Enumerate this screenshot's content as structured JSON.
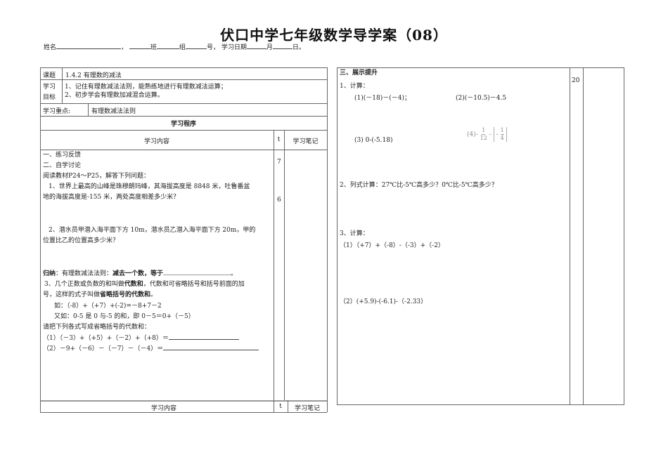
{
  "title": "伏口中学七年级数学导学案（08）",
  "info_line": {
    "name": "姓名",
    "class": "班",
    "group": "组",
    "number": "号，",
    "date_label": "学习日期",
    "month": "月",
    "day": "日。",
    "comma": "，"
  },
  "left": {
    "topic_label": "课题",
    "topic": "1.4.2 有理数的减法",
    "goal_label_1": "学习",
    "goal_label_2": "目标",
    "goals": [
      "1、记住有理数减法法则，能熟练地进行有理数减法运算；",
      "2、初步学会有理数加减混合运算。"
    ],
    "focus_label": "学习重点:",
    "focus": "有理数减法法则",
    "procedure": "学习程序",
    "col_content": "学习内容",
    "col_t": "t",
    "col_notes": "学习笔记",
    "t_values": [
      "7",
      "6"
    ],
    "lines": {
      "s1": "一、练习反馈",
      "s2": "二、自学讨论",
      "read": "阅读教材P24～P25，解答下列问题：",
      "q1a": "1、世界上最高的山峰是珠穆朗玛峰，其海拔高度是 8848 米，吐鲁番盆",
      "q1b": "地的海拔高度是-155 米，两处高度相差多少米？",
      "q2a": "2、潜水员甲潜入海平面下方 10m，潜水员乙潜入海平面下方 20m，甲的",
      "q2b": "位置比乙的位置高多少米？",
      "sum_label": "归纳",
      "sum_text": "：有理数减法法则：",
      "sum_bold": "减去一个数，等于",
      "sum_end": "。",
      "q3a_1": "3、几个正数或负数的和叫做",
      "q3a_b1": "代数和",
      "q3a_2": "，代数和可省略括号和括号前面的加",
      "q3b_1": "号，这样的式子叫做",
      "q3b_b": "省略括号的代数和",
      "q3b_2": "。",
      "ex1": "如：（-8）+（+7）+(-2)=－8+7－2",
      "ex2": "又如：0-5 是 0 与-5 的和，即 0－5＝0+（－5）",
      "ask": "请把下列各式写成省略括号的代数和：",
      "e1": "（1）（－3）+（+5）+（－2）+（+8）＝",
      "e2": "（2）－9+（－6）－（－7）－（－4）＝"
    },
    "footer_content": "学习内容",
    "footer_t": "t",
    "footer_notes": "学习笔记"
  },
  "right": {
    "section": "三、展示提升",
    "t_value": "20",
    "c1": "1、计算：",
    "p1": "(1)(－18)－(－4)；",
    "p2": "(2)(－10.5)－4.5",
    "p3": "(3) 0-(-5.18)",
    "p4_pre": "(4)-",
    "p4_n1": "1",
    "p4_d1": "12",
    "p4_mid": "-",
    "p4_inner": "-",
    "p4_n2": "1",
    "p4_d2": "4",
    "c2": "2、列式计算：27℃比-5℃高多少？0℃比-5℃高多少？",
    "c3": "3、计算：",
    "r1": "（1）（+7）+（-8）-（-3）+（-2）",
    "r2": "（2）(+5.9)-(-6.1)-（-2.33）"
  }
}
